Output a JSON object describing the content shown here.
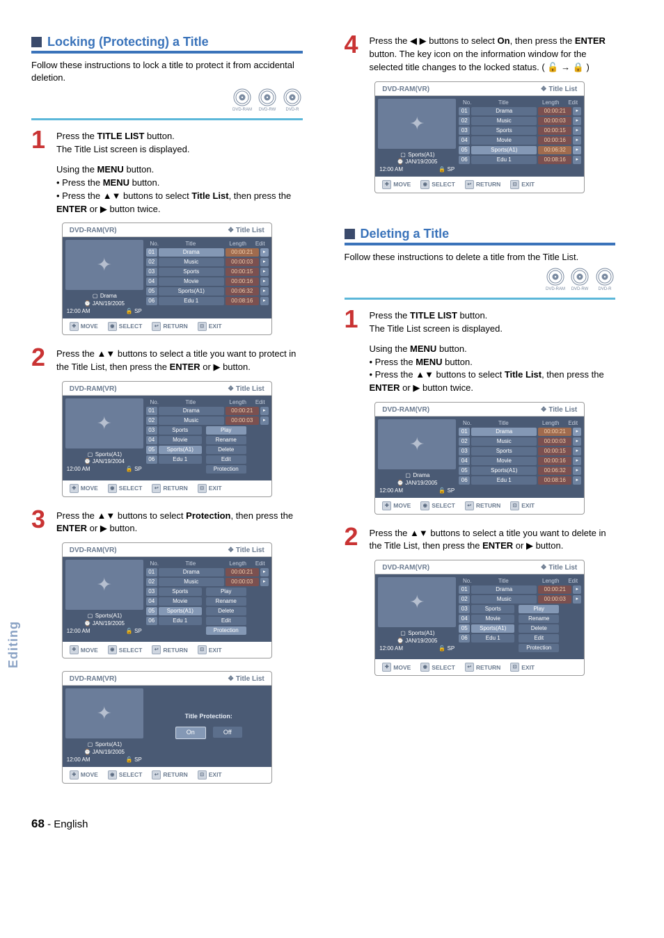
{
  "page": {
    "number": "68",
    "lang": "English",
    "sideTab": "Editing",
    "dash": " - "
  },
  "common": {
    "titleListBtn": "TITLE LIST",
    "menuBtn": "MENU",
    "enterBtn": "ENTER",
    "titleListWords": "Title List",
    "protectionWord": "Protection",
    "onWord": "On",
    "footer": {
      "move": "MOVE",
      "select": "SELECT",
      "return": "RETURN",
      "exit": "EXIT"
    }
  },
  "screen": {
    "device": "DVD-RAM(VR)",
    "headerRight": "Title List",
    "cols": {
      "no": "No.",
      "title": "Title",
      "length": "Length",
      "edit": "Edit"
    },
    "rows": [
      {
        "no": "01",
        "title": "Drama",
        "len": "00:00:21"
      },
      {
        "no": "02",
        "title": "Music",
        "len": "00:00:03"
      },
      {
        "no": "03",
        "title": "Sports",
        "len": "00:00:15"
      },
      {
        "no": "04",
        "title": "Movie",
        "len": "00:00:16"
      },
      {
        "no": "05",
        "title": "Sports(A1)",
        "len": "00:06:32"
      },
      {
        "no": "06",
        "title": "Edu 1",
        "len": "00:08:16"
      }
    ],
    "info": {
      "titleDrama": "Drama",
      "titleSports": "Sports(A1)",
      "date2005": "JAN/19/2005",
      "date2004": "JAN/19/2004",
      "time": "12:00 AM",
      "sp": "SP"
    },
    "ctx": {
      "play": "Play",
      "rename": "Rename",
      "delete": "Delete",
      "edit": "Edit",
      "protection": "Protection"
    },
    "protect": {
      "label": "Title Protection:",
      "on": "On",
      "off": "Off"
    }
  },
  "left": {
    "heading": "Locking (Protecting) a Title",
    "intro": "Follow these instructions to lock a title to protect it from accidental deletion.",
    "step1a": "Press the ",
    "step1b": " button.",
    "step1c": "The Title List screen is displayed.",
    "usingMenu": "Using the ",
    "usingMenu2": " button.",
    "pressMenu": "Press the ",
    "pressMenu2": " button.",
    "pressArrows1": "Press the ",
    "pressArrows2": " buttons to select ",
    "pressArrows3": ", then press the ",
    "pressArrows4": " or ",
    "pressArrows5": " button twice.",
    "step2a": "Press the ",
    "step2b": " buttons to select a title you want to protect in the Title List, then press the ",
    "step2c": " or ",
    "step2d": " button.",
    "step3a": "Press the ",
    "step3b": " buttons to select ",
    "step3c": ", then press the ",
    "step3d": " or ",
    "step3e": " button."
  },
  "right": {
    "step4a": "Press the ",
    "step4b": " buttons to select ",
    "step4c": ", then press the ",
    "step4d": " button. The key icon on the information window for the selected title changes to the locked status. ( ",
    "step4e": " )",
    "heading": "Deleting a Title",
    "intro": "Follow these instructions to delete a title from the Title List.",
    "step1a": "Press the ",
    "step1b": " button.",
    "step1c": "The Title List screen is displayed.",
    "usingMenu": "Using the ",
    "usingMenu2": " button.",
    "pressMenu": "Press the ",
    "pressMenu2": " button.",
    "pressArrows1": "Press the ",
    "pressArrows2": " buttons to select ",
    "pressArrows3": ", then press the ",
    "pressArrows4": " or ",
    "pressArrows5": " button twice.",
    "step2a": "Press the ",
    "step2b": " buttons to select a title you want to delete in the Title List, then press the ",
    "step2c": " or ",
    "step2d": " button."
  }
}
